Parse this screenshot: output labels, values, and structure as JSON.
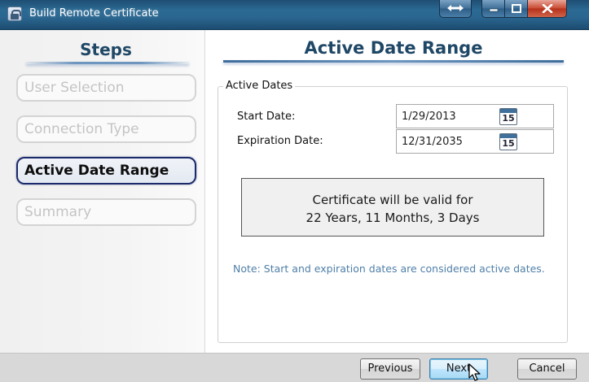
{
  "window": {
    "title": "Build Remote Certificate"
  },
  "steps": {
    "title": "Steps",
    "items": [
      {
        "label": "User Selection",
        "active": false
      },
      {
        "label": "Connection Type",
        "active": false
      },
      {
        "label": "Active Date Range",
        "active": true
      },
      {
        "label": "Summary",
        "active": false
      }
    ]
  },
  "main": {
    "title": "Active Date Range",
    "group_label": "Active Dates",
    "start_label": "Start Date:",
    "start_value": "1/29/2013",
    "expiration_label": "Expiration Date:",
    "expiration_value": "12/31/2035",
    "calendar_icon_text": "15",
    "summary_line1": "Certificate will be valid for",
    "summary_line2": "22 Years, 11 Months, 3 Days",
    "note": "Note:  Start and expiration dates are considered active dates."
  },
  "buttons": {
    "previous": "Previous",
    "next": "Next",
    "cancel": "Cancel"
  },
  "colors": {
    "heading": "#1f4766",
    "note": "#4f7fa8",
    "active_step_border": "#1b2a6a"
  }
}
